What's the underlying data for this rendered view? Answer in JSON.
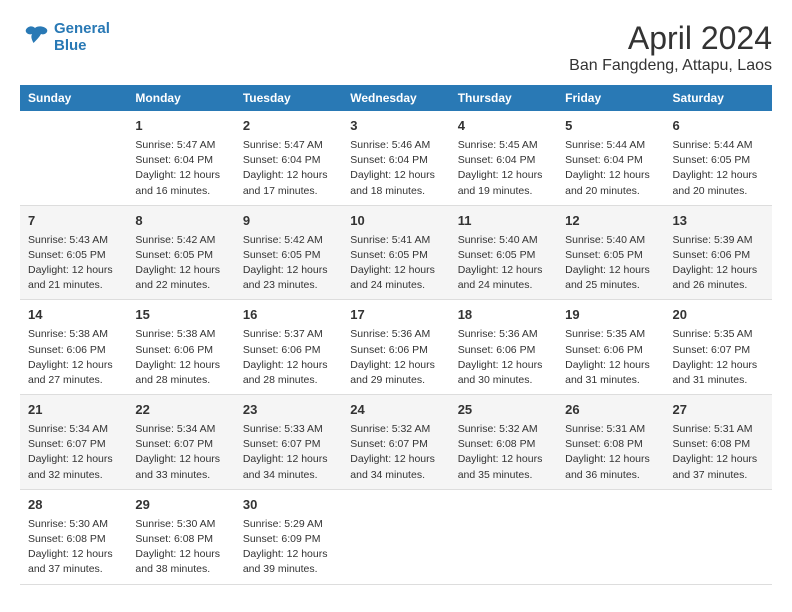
{
  "header": {
    "logo_line1": "General",
    "logo_line2": "Blue",
    "main_title": "April 2024",
    "sub_title": "Ban Fangdeng, Attapu, Laos"
  },
  "columns": [
    "Sunday",
    "Monday",
    "Tuesday",
    "Wednesday",
    "Thursday",
    "Friday",
    "Saturday"
  ],
  "weeks": [
    {
      "cells": [
        {
          "day": "",
          "info": ""
        },
        {
          "day": "1",
          "info": "Sunrise: 5:47 AM\nSunset: 6:04 PM\nDaylight: 12 hours\nand 16 minutes."
        },
        {
          "day": "2",
          "info": "Sunrise: 5:47 AM\nSunset: 6:04 PM\nDaylight: 12 hours\nand 17 minutes."
        },
        {
          "day": "3",
          "info": "Sunrise: 5:46 AM\nSunset: 6:04 PM\nDaylight: 12 hours\nand 18 minutes."
        },
        {
          "day": "4",
          "info": "Sunrise: 5:45 AM\nSunset: 6:04 PM\nDaylight: 12 hours\nand 19 minutes."
        },
        {
          "day": "5",
          "info": "Sunrise: 5:44 AM\nSunset: 6:04 PM\nDaylight: 12 hours\nand 20 minutes."
        },
        {
          "day": "6",
          "info": "Sunrise: 5:44 AM\nSunset: 6:05 PM\nDaylight: 12 hours\nand 20 minutes."
        }
      ]
    },
    {
      "cells": [
        {
          "day": "7",
          "info": "Sunrise: 5:43 AM\nSunset: 6:05 PM\nDaylight: 12 hours\nand 21 minutes."
        },
        {
          "day": "8",
          "info": "Sunrise: 5:42 AM\nSunset: 6:05 PM\nDaylight: 12 hours\nand 22 minutes."
        },
        {
          "day": "9",
          "info": "Sunrise: 5:42 AM\nSunset: 6:05 PM\nDaylight: 12 hours\nand 23 minutes."
        },
        {
          "day": "10",
          "info": "Sunrise: 5:41 AM\nSunset: 6:05 PM\nDaylight: 12 hours\nand 24 minutes."
        },
        {
          "day": "11",
          "info": "Sunrise: 5:40 AM\nSunset: 6:05 PM\nDaylight: 12 hours\nand 24 minutes."
        },
        {
          "day": "12",
          "info": "Sunrise: 5:40 AM\nSunset: 6:05 PM\nDaylight: 12 hours\nand 25 minutes."
        },
        {
          "day": "13",
          "info": "Sunrise: 5:39 AM\nSunset: 6:06 PM\nDaylight: 12 hours\nand 26 minutes."
        }
      ]
    },
    {
      "cells": [
        {
          "day": "14",
          "info": "Sunrise: 5:38 AM\nSunset: 6:06 PM\nDaylight: 12 hours\nand 27 minutes."
        },
        {
          "day": "15",
          "info": "Sunrise: 5:38 AM\nSunset: 6:06 PM\nDaylight: 12 hours\nand 28 minutes."
        },
        {
          "day": "16",
          "info": "Sunrise: 5:37 AM\nSunset: 6:06 PM\nDaylight: 12 hours\nand 28 minutes."
        },
        {
          "day": "17",
          "info": "Sunrise: 5:36 AM\nSunset: 6:06 PM\nDaylight: 12 hours\nand 29 minutes."
        },
        {
          "day": "18",
          "info": "Sunrise: 5:36 AM\nSunset: 6:06 PM\nDaylight: 12 hours\nand 30 minutes."
        },
        {
          "day": "19",
          "info": "Sunrise: 5:35 AM\nSunset: 6:06 PM\nDaylight: 12 hours\nand 31 minutes."
        },
        {
          "day": "20",
          "info": "Sunrise: 5:35 AM\nSunset: 6:07 PM\nDaylight: 12 hours\nand 31 minutes."
        }
      ]
    },
    {
      "cells": [
        {
          "day": "21",
          "info": "Sunrise: 5:34 AM\nSunset: 6:07 PM\nDaylight: 12 hours\nand 32 minutes."
        },
        {
          "day": "22",
          "info": "Sunrise: 5:34 AM\nSunset: 6:07 PM\nDaylight: 12 hours\nand 33 minutes."
        },
        {
          "day": "23",
          "info": "Sunrise: 5:33 AM\nSunset: 6:07 PM\nDaylight: 12 hours\nand 34 minutes."
        },
        {
          "day": "24",
          "info": "Sunrise: 5:32 AM\nSunset: 6:07 PM\nDaylight: 12 hours\nand 34 minutes."
        },
        {
          "day": "25",
          "info": "Sunrise: 5:32 AM\nSunset: 6:08 PM\nDaylight: 12 hours\nand 35 minutes."
        },
        {
          "day": "26",
          "info": "Sunrise: 5:31 AM\nSunset: 6:08 PM\nDaylight: 12 hours\nand 36 minutes."
        },
        {
          "day": "27",
          "info": "Sunrise: 5:31 AM\nSunset: 6:08 PM\nDaylight: 12 hours\nand 37 minutes."
        }
      ]
    },
    {
      "cells": [
        {
          "day": "28",
          "info": "Sunrise: 5:30 AM\nSunset: 6:08 PM\nDaylight: 12 hours\nand 37 minutes."
        },
        {
          "day": "29",
          "info": "Sunrise: 5:30 AM\nSunset: 6:08 PM\nDaylight: 12 hours\nand 38 minutes."
        },
        {
          "day": "30",
          "info": "Sunrise: 5:29 AM\nSunset: 6:09 PM\nDaylight: 12 hours\nand 39 minutes."
        },
        {
          "day": "",
          "info": ""
        },
        {
          "day": "",
          "info": ""
        },
        {
          "day": "",
          "info": ""
        },
        {
          "day": "",
          "info": ""
        }
      ]
    }
  ]
}
